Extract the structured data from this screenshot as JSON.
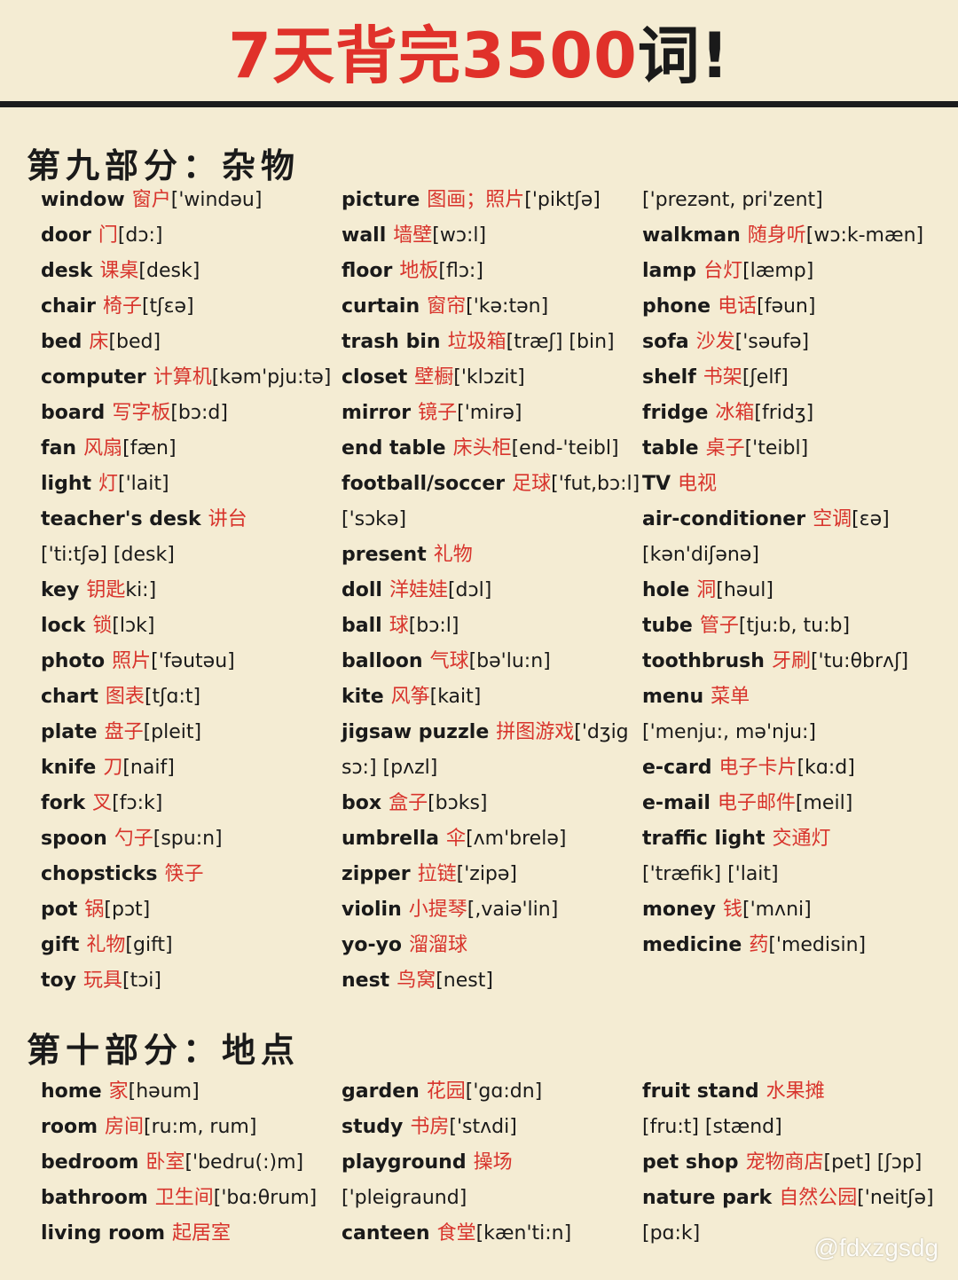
{
  "title": {
    "part1": "7天背完",
    "part2": "3500",
    "part3": "词!"
  },
  "section9": {
    "heading": "第九部分：杂物",
    "columns": [
      [
        {
          "word": "window",
          "cn": "窗户",
          "ph": "['windəu]"
        },
        {
          "word": "door",
          "cn": "门",
          "ph": "[dɔ:]"
        },
        {
          "word": "desk",
          "cn": "课桌",
          "ph": "[desk]"
        },
        {
          "word": "chair",
          "cn": "椅子",
          "ph": "[tʃɛə]"
        },
        {
          "word": "bed",
          "cn": "床",
          "ph": "[bed]"
        },
        {
          "word": "computer",
          "cn": "计算机",
          "ph": "[kəm'pju:tə]"
        },
        {
          "word": "board",
          "cn": "写字板",
          "ph": "[bɔ:d]"
        },
        {
          "word": "fan",
          "cn": "风扇",
          "ph": "[fæn]"
        },
        {
          "word": "light",
          "cn": "灯",
          "ph": "['lait]"
        },
        {
          "word": "teacher's desk",
          "cn": "讲台",
          "ph": ""
        },
        {
          "word": "",
          "cn": "",
          "ph": "['ti:tʃə] [desk]"
        },
        {
          "word": "key",
          "cn": "钥匙",
          "ph": "ki:]"
        },
        {
          "word": "lock",
          "cn": "锁",
          "ph": "[lɔk]"
        },
        {
          "word": "photo",
          "cn": "照片",
          "ph": "['fəutəu]"
        },
        {
          "word": "chart",
          "cn": "图表",
          "ph": "[tʃɑ:t]"
        },
        {
          "word": "plate",
          "cn": "盘子",
          "ph": "[pleit]"
        },
        {
          "word": "knife",
          "cn": "刀",
          "ph": "[naif]"
        },
        {
          "word": "fork",
          "cn": "叉",
          "ph": "[fɔ:k]"
        },
        {
          "word": "spoon",
          "cn": "勺子",
          "ph": "[spu:n]"
        },
        {
          "word": "chopsticks",
          "cn": "筷子",
          "ph": ""
        },
        {
          "word": "pot",
          "cn": "锅",
          "ph": "[pɔt]"
        },
        {
          "word": "gift",
          "cn": "礼物",
          "ph": "[gift]"
        },
        {
          "word": "toy",
          "cn": "玩具",
          "ph": "[tɔi]"
        }
      ],
      [
        {
          "word": "picture",
          "cn": "图画；照片",
          "ph": "['piktʃə]"
        },
        {
          "word": "wall",
          "cn": "墙壁",
          "ph": "[wɔ:l]"
        },
        {
          "word": "floor",
          "cn": "地板",
          "ph": "[flɔ:]"
        },
        {
          "word": "curtain",
          "cn": "窗帘",
          "ph": "['kə:tən]"
        },
        {
          "word": "trash bin",
          "cn": "垃圾箱",
          "ph": "[træʃ] [bin]"
        },
        {
          "word": "closet",
          "cn": "壁橱",
          "ph": "['klɔzit]"
        },
        {
          "word": "mirror",
          "cn": "镜子",
          "ph": "['mirə]"
        },
        {
          "word": "end table",
          "cn": "床头柜",
          "ph": "[end-'teibl]"
        },
        {
          "word": "football/soccer",
          "cn": "足球",
          "ph": "['fut,bɔ:l]"
        },
        {
          "word": "",
          "cn": "",
          "ph": "['sɔkə]"
        },
        {
          "word": "present",
          "cn": "礼物",
          "ph": ""
        },
        {
          "word": "doll",
          "cn": "洋娃娃",
          "ph": "[dɔl]"
        },
        {
          "word": "ball",
          "cn": "球",
          "ph": "[bɔ:l]"
        },
        {
          "word": "balloon",
          "cn": "气球",
          "ph": "[bə'lu:n]"
        },
        {
          "word": "kite",
          "cn": "风筝",
          "ph": "[kait]"
        },
        {
          "word": "jigsaw puzzle",
          "cn": "拼图游戏",
          "ph": "['dʒig"
        },
        {
          "word": "",
          "cn": "",
          "ph": "sɔ:] [pʌzl]"
        },
        {
          "word": "box",
          "cn": "盒子",
          "ph": "[bɔks]"
        },
        {
          "word": "umbrella",
          "cn": "伞",
          "ph": "[ʌm'brelə]"
        },
        {
          "word": "zipper",
          "cn": "拉链",
          "ph": "['zipə]"
        },
        {
          "word": "violin",
          "cn": "小提琴",
          "ph": "[,vaiə'lin]"
        },
        {
          "word": "yo-yo",
          "cn": "溜溜球",
          "ph": ""
        },
        {
          "word": "nest",
          "cn": "鸟窝",
          "ph": "[nest]"
        }
      ],
      [
        {
          "word": "",
          "cn": "",
          "ph": "['prezənt, pri'zent]"
        },
        {
          "word": "walkman",
          "cn": "随身听",
          "ph": "[wɔ:k-mæn]"
        },
        {
          "word": "lamp",
          "cn": "台灯",
          "ph": "[læmp]"
        },
        {
          "word": "phone",
          "cn": "电话",
          "ph": "[fəun]"
        },
        {
          "word": "sofa",
          "cn": "沙发",
          "ph": "['səufə]"
        },
        {
          "word": "shelf",
          "cn": "书架",
          "ph": "[ʃelf]"
        },
        {
          "word": "fridge",
          "cn": "冰箱",
          "ph": "[fridʒ]"
        },
        {
          "word": "table",
          "cn": "桌子",
          "ph": "['teibl]"
        },
        {
          "word": "TV",
          "cn": "电视",
          "ph": ""
        },
        {
          "word": "air-conditioner",
          "cn": "空调",
          "ph": "[ɛə]"
        },
        {
          "word": "",
          "cn": "",
          "ph": "[kən'diʃənə]"
        },
        {
          "word": "hole",
          "cn": "洞",
          "ph": "[həul]"
        },
        {
          "word": "tube",
          "cn": "管子",
          "ph": "[tju:b, tu:b]"
        },
        {
          "word": "toothbrush",
          "cn": "牙刷",
          "ph": "['tu:θbrʌʃ]"
        },
        {
          "word": "menu",
          "cn": "菜单",
          "ph": ""
        },
        {
          "word": "",
          "cn": "",
          "ph": "['menju:, mə'nju:]"
        },
        {
          "word": "e-card",
          "cn": "电子卡片",
          "ph": "[kɑ:d]"
        },
        {
          "word": "e-mail",
          "cn": "电子邮件",
          "ph": "[meil]"
        },
        {
          "word": "traffic light",
          "cn": "交通灯",
          "ph": ""
        },
        {
          "word": "",
          "cn": "",
          "ph": "['træfik] ['lait]"
        },
        {
          "word": "money",
          "cn": "钱",
          "ph": "['mʌni]"
        },
        {
          "word": "medicine",
          "cn": "药",
          "ph": "['medisin]"
        }
      ]
    ]
  },
  "section10": {
    "heading": "第十部分：地点",
    "columns": [
      [
        {
          "word": "home",
          "cn": "家",
          "ph": "[həum]"
        },
        {
          "word": "room",
          "cn": "房间",
          "ph": "[ru:m, rum]"
        },
        {
          "word": "bedroom",
          "cn": "卧室",
          "ph": "['bedru(:)m]"
        },
        {
          "word": "bathroom",
          "cn": "卫生间",
          "ph": "['bɑ:θrum]"
        },
        {
          "word": "living room",
          "cn": "起居室",
          "ph": ""
        }
      ],
      [
        {
          "word": "garden",
          "cn": "花园",
          "ph": "['gɑ:dn]"
        },
        {
          "word": "study",
          "cn": "书房",
          "ph": "['stʌdi]"
        },
        {
          "word": "playground",
          "cn": "操场",
          "ph": ""
        },
        {
          "word": "",
          "cn": "",
          "ph": "['pleigraund]"
        },
        {
          "word": "canteen",
          "cn": "食堂",
          "ph": "[kæn'ti:n]"
        }
      ],
      [
        {
          "word": "fruit stand",
          "cn": "水果摊",
          "ph": ""
        },
        {
          "word": "",
          "cn": "",
          "ph": "[fru:t] [stænd]"
        },
        {
          "word": "pet shop",
          "cn": "宠物商店",
          "ph": "[pet] [ʃɔp]"
        },
        {
          "word": "nature park",
          "cn": "自然公园",
          "ph": "['neitʃə]"
        },
        {
          "word": "",
          "cn": "",
          "ph": "[pɑ:k]"
        }
      ]
    ]
  },
  "watermark": "@fdxzgsdg"
}
